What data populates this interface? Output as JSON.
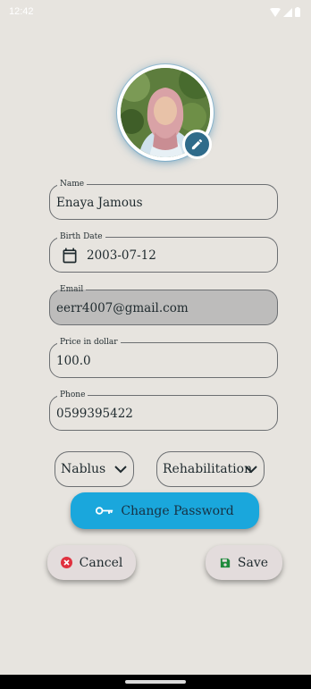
{
  "status": {
    "time": "12:42"
  },
  "profile": {
    "avatar_alt": "profile photo"
  },
  "fields": {
    "name": {
      "label": "Name",
      "value": "Enaya Jamous"
    },
    "birth_date": {
      "label": "Birth Date",
      "value": "2003-07-12"
    },
    "email": {
      "label": "Email",
      "value": "eerr4007@gmail.com"
    },
    "price": {
      "label": "Price in dollar",
      "value": "100.0"
    },
    "phone": {
      "label": "Phone",
      "value": "0599395422"
    }
  },
  "dropdowns": {
    "city": {
      "selected": "Nablus"
    },
    "specialty": {
      "selected": "Rehabilitation"
    }
  },
  "buttons": {
    "change_password": "Change Password",
    "cancel": "Cancel",
    "save": "Save"
  },
  "colors": {
    "background": "#e7e4df",
    "primary": "#1aa7dc",
    "edit_badge": "#2f6b8a",
    "cancel_icon": "#e0313f",
    "save_icon": "#1f8a3c",
    "readonly_field": "#bdbcbb"
  },
  "icons": {
    "edit": "pencil-icon",
    "calendar": "calendar-icon",
    "key": "key-icon",
    "cancel": "cancel-circle-icon",
    "save": "save-disk-icon",
    "dropdown": "chevron-down-icon"
  }
}
